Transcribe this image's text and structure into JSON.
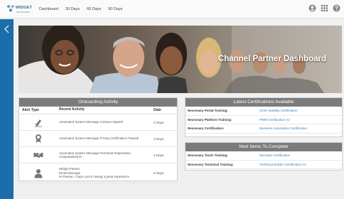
{
  "logo": {
    "name": "WIDGET",
    "sub": "NETWORKS"
  },
  "nav": [
    "Dashboard",
    "30 Days",
    "60 Days",
    "90 Days"
  ],
  "hero": {
    "title": "Channel Partner Dashboard"
  },
  "onboarding": {
    "title": "Onboarding Activity",
    "columns": {
      "type": "Alert Type",
      "activity": "Recent Activity",
      "date": "Date"
    },
    "rows": [
      {
        "icon": "pen-signature-icon",
        "activity": "Automated System Message Contract Signed!",
        "date": "2 Days"
      },
      {
        "icon": "award-ribbon-icon",
        "activity": "Automated System Message Pricing Certification Passed!",
        "date": "3 Days"
      },
      {
        "icon": "handshake-icon",
        "activity": "Automated System Message First Deal Registration, Congratulations!",
        "date": "4 Days"
      },
      {
        "icon": "person-icon",
        "activity": "Widget Partner\nEmail Message\nHi Partner, I hope you're having a great experience",
        "date": "6 Days"
      }
    ]
  },
  "certifications": {
    "title": "Latest Certifications Available",
    "rows": [
      {
        "label": "Necessary Portal Training:",
        "value": "UCM Usability Certification"
      },
      {
        "label": "Necessary Platform Training:",
        "value": "PWM Certification V2"
      },
      {
        "label": "Necessary Certification:",
        "value": "Business Automation Certification"
      }
    ]
  },
  "next_items": {
    "title": "Next Items To Complete",
    "rows": [
      {
        "label": "Necessary Tactic Training:",
        "value": "Microsite Certification"
      },
      {
        "label": "Necessary Technical Training:",
        "value": "Technical Builder Certification V1"
      }
    ]
  },
  "colors": {
    "sidebar": "#1c6eaa",
    "panel_header": "#7b7b7b",
    "link": "#2f7fbf"
  }
}
